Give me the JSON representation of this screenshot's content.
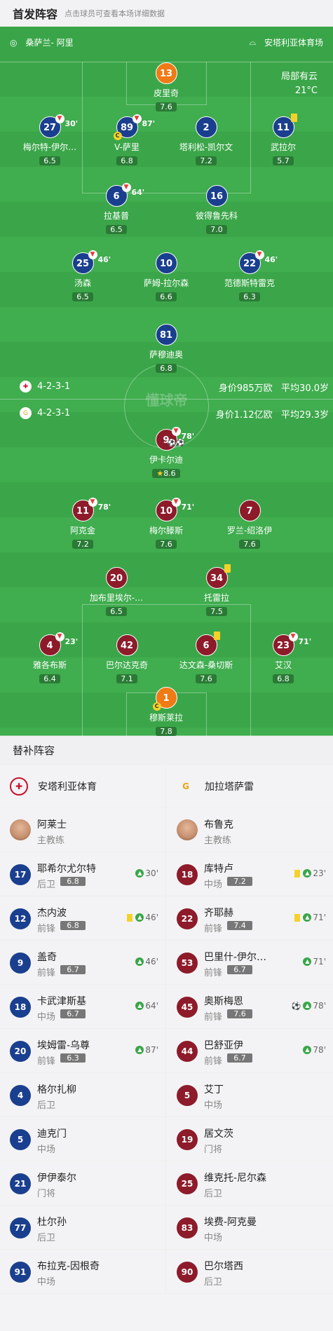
{
  "header": {
    "title": "首发阵容",
    "subtitle": "点击球员可查看本场详细数据"
  },
  "pitch": {
    "referee": "桑萨兰- 阿里",
    "stadium": "安塔利亚体育场",
    "weather": "局部有云",
    "temperature": "21°C",
    "watermark": "懂球帝",
    "home_formation": "4-2-3-1",
    "home_value": "身价985万欧",
    "home_age": "平均30.0岁",
    "away_formation": "4-2-3-1",
    "away_value": "身价1.12亿欧",
    "away_age": "平均29.3岁"
  },
  "home_players": [
    {
      "num": "13",
      "name": "皮里奇",
      "rating": "7.6"
    },
    {
      "num": "27",
      "name": "梅尔特-伊尔…",
      "rating": "6.5",
      "sub": "30'"
    },
    {
      "num": "89",
      "name": "V-萨里",
      "rating": "6.8",
      "sub": "87'",
      "cap": "C"
    },
    {
      "num": "2",
      "name": "塔利松-凯尔文",
      "rating": "7.2"
    },
    {
      "num": "11",
      "name": "武拉尔",
      "rating": "5.7"
    },
    {
      "num": "6",
      "name": "拉基普",
      "rating": "6.5",
      "sub": "64'"
    },
    {
      "num": "16",
      "name": "彼得鲁先科",
      "rating": "7.0"
    },
    {
      "num": "25",
      "name": "汤森",
      "rating": "6.5",
      "sub": "46'"
    },
    {
      "num": "10",
      "name": "萨姆-拉尔森",
      "rating": "6.6"
    },
    {
      "num": "22",
      "name": "范德斯特雷克",
      "rating": "6.3",
      "sub": "46'"
    },
    {
      "num": "81",
      "name": "萨穆迪奥",
      "rating": "6.8"
    }
  ],
  "away_players": [
    {
      "num": "9",
      "name": "伊卡尔迪",
      "rating": "8.6",
      "sub": "78'"
    },
    {
      "num": "11",
      "name": "阿克金",
      "rating": "7.2",
      "sub": "78'"
    },
    {
      "num": "10",
      "name": "梅尔滕斯",
      "rating": "7.6",
      "sub": "71'"
    },
    {
      "num": "7",
      "name": "罗兰-绍洛伊",
      "rating": "7.6"
    },
    {
      "num": "20",
      "name": "加布里埃尔-…",
      "rating": "6.5"
    },
    {
      "num": "34",
      "name": "托雷拉",
      "rating": "7.5"
    },
    {
      "num": "4",
      "name": "雅各布斯",
      "rating": "6.4",
      "sub": "23'"
    },
    {
      "num": "42",
      "name": "巴尔达克奇",
      "rating": "7.1"
    },
    {
      "num": "6",
      "name": "达文森-桑切斯",
      "rating": "7.6"
    },
    {
      "num": "23",
      "name": "艾汉",
      "rating": "6.8",
      "sub": "71'"
    },
    {
      "num": "1",
      "name": "穆斯莱拉",
      "rating": "7.8",
      "cap": "C"
    }
  ],
  "subs": {
    "title": "替补阵容",
    "home_team": "安塔利亚体育",
    "away_team": "加拉塔萨雷",
    "home_coach": {
      "name": "阿莱士",
      "role": "主教练"
    },
    "away_coach": {
      "name": "布鲁克",
      "role": "主教练"
    },
    "home": [
      {
        "num": "17",
        "name": "耶希尔尤尔特",
        "pos": "后卫",
        "rating": "6.8",
        "time": "30'"
      },
      {
        "num": "12",
        "name": "杰内波",
        "pos": "前锋",
        "rating": "6.8",
        "time": "46'"
      },
      {
        "num": "9",
        "name": "盖奇",
        "pos": "前锋",
        "rating": "6.7",
        "time": "46'"
      },
      {
        "num": "18",
        "name": "卡武津斯基",
        "pos": "中场",
        "rating": "6.7",
        "time": "64'"
      },
      {
        "num": "20",
        "name": "埃姆雷-乌尊",
        "pos": "前锋",
        "rating": "6.3",
        "time": "87'"
      },
      {
        "num": "4",
        "name": "格尔扎柳",
        "pos": "后卫"
      },
      {
        "num": "5",
        "name": "迪克门",
        "pos": "中场"
      },
      {
        "num": "21",
        "name": "伊伊泰尔",
        "pos": "门将"
      },
      {
        "num": "77",
        "name": "杜尔孙",
        "pos": "后卫"
      },
      {
        "num": "91",
        "name": "布拉克-因根奇",
        "pos": "中场"
      }
    ],
    "away": [
      {
        "num": "18",
        "name": "库特卢",
        "pos": "中场",
        "rating": "7.2",
        "time": "23'"
      },
      {
        "num": "22",
        "name": "齐耶赫",
        "pos": "前锋",
        "rating": "7.4",
        "time": "71'"
      },
      {
        "num": "53",
        "name": "巴里什-伊尔…",
        "pos": "前锋",
        "rating": "6.7",
        "time": "71'"
      },
      {
        "num": "45",
        "name": "奥斯梅恩",
        "pos": "前锋",
        "rating": "7.6",
        "time": "78'"
      },
      {
        "num": "44",
        "name": "巴舒亚伊",
        "pos": "前锋",
        "rating": "6.7",
        "time": "78'"
      },
      {
        "num": "5",
        "name": "艾丁",
        "pos": "中场"
      },
      {
        "num": "19",
        "name": "居文茨",
        "pos": "门将"
      },
      {
        "num": "25",
        "name": "维克托-尼尔森",
        "pos": "后卫"
      },
      {
        "num": "83",
        "name": "埃费-阿克曼",
        "pos": "中场"
      },
      {
        "num": "90",
        "name": "巴尔塔西",
        "pos": "后卫"
      }
    ]
  }
}
